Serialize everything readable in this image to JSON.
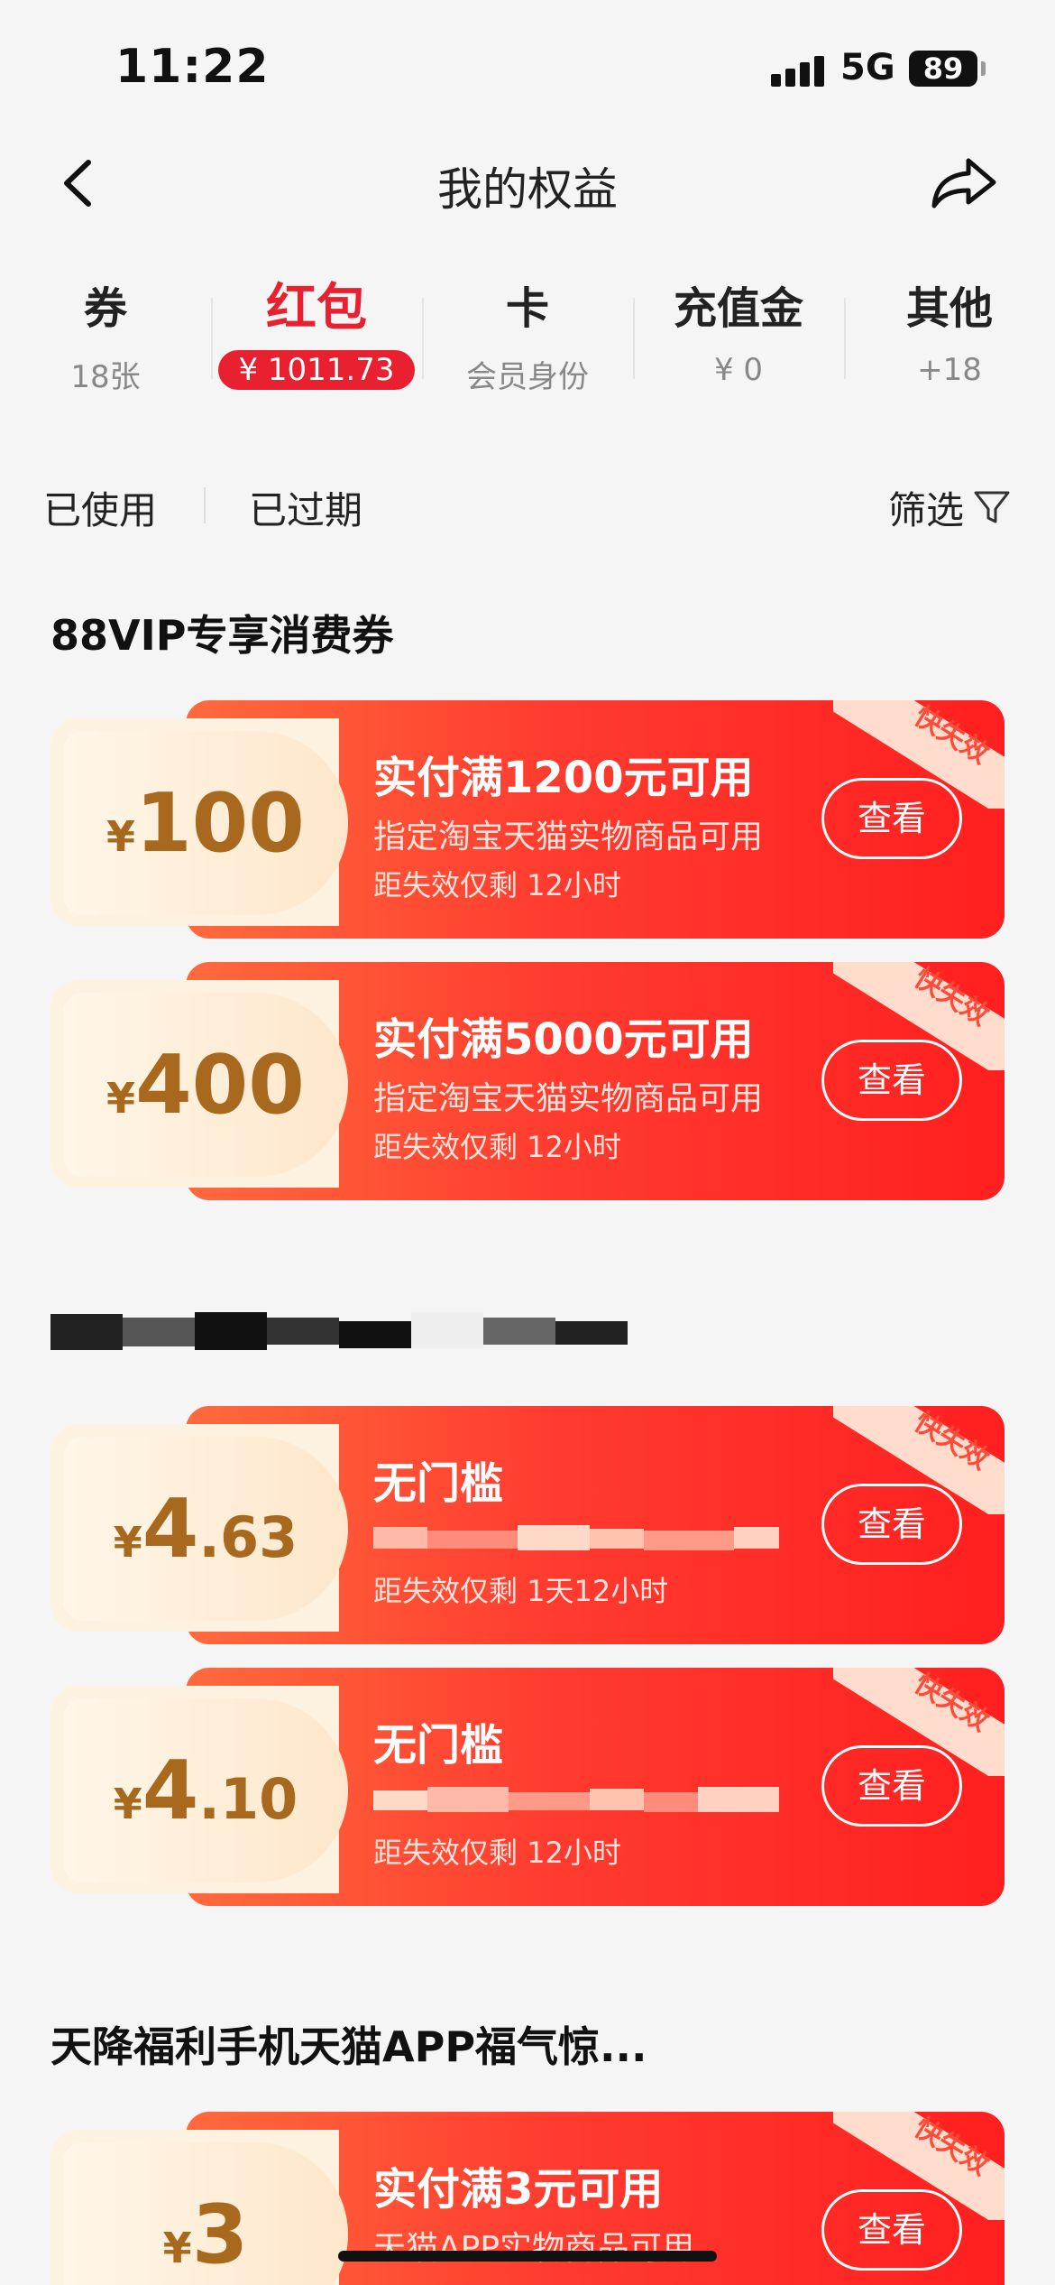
{
  "status_bar": {
    "time": "11:22",
    "network": "5G",
    "battery": "89"
  },
  "nav": {
    "title": "我的权益"
  },
  "tabs": [
    {
      "label": "券",
      "sub": "18张"
    },
    {
      "label": "红包",
      "sub": "¥ 1011.73"
    },
    {
      "label": "卡",
      "sub": "会员身份"
    },
    {
      "label": "充值金",
      "sub": "¥ 0"
    },
    {
      "label": "其他",
      "sub": "+18"
    }
  ],
  "active_tab": "红包",
  "filters": {
    "used": "已使用",
    "expired": "已过期",
    "filter": "筛选"
  },
  "sections": [
    {
      "title": "88VIP专享消费券",
      "coupons": [
        {
          "yen": "¥",
          "amount_int": "100",
          "amount_dec": "",
          "title": "实付满1200元可用",
          "desc": "指定淘宝天猫实物商品可用",
          "expire": "距失效仅剩 12小时",
          "button": "查看",
          "ribbon": "快失效"
        },
        {
          "yen": "¥",
          "amount_int": "400",
          "amount_dec": "",
          "title": "实付满5000元可用",
          "desc": "指定淘宝天猫实物商品可用",
          "expire": "距失效仅剩 12小时",
          "button": "查看",
          "ribbon": "快失效"
        }
      ]
    },
    {
      "title": "",
      "coupons": [
        {
          "yen": "¥",
          "amount_int": "4",
          "amount_dec": ".63",
          "title": "无门槛",
          "desc": "",
          "expire": "距失效仅剩 1天12小时",
          "button": "查看",
          "ribbon": "快失效"
        },
        {
          "yen": "¥",
          "amount_int": "4",
          "amount_dec": ".10",
          "title": "无门槛",
          "desc": "",
          "expire": "距失效仅剩 12小时",
          "button": "查看",
          "ribbon": "快失效"
        }
      ]
    },
    {
      "title": "天降福利手机天猫APP福气惊...",
      "coupons": [
        {
          "yen": "¥",
          "amount_int": "3",
          "amount_dec": "",
          "title": "实付满3元可用",
          "desc": "天猫APP实物商品可用",
          "expire": "",
          "button": "查看",
          "ribbon": "快失效"
        }
      ]
    }
  ],
  "colors": {
    "accent": "#e8202f",
    "coupon_gold": "#a8691f"
  }
}
